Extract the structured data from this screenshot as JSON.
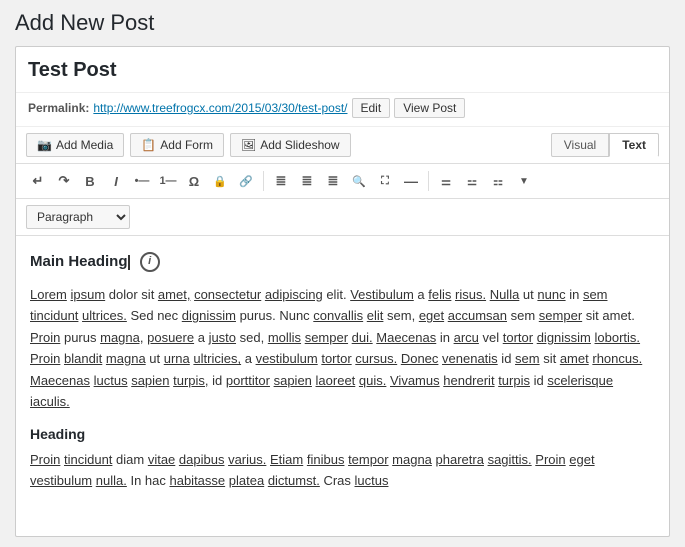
{
  "page": {
    "title": "Add New Post"
  },
  "post": {
    "title": "Test Post",
    "permalink_label": "Permalink:",
    "permalink_url": "http://www.treefrogcx.com/2015/03/30/test-post/",
    "edit_btn": "Edit",
    "view_post_btn": "View Post"
  },
  "toolbar_top": {
    "add_media_label": "Add Media",
    "add_form_label": "Add Form",
    "add_slideshow_label": "Add Slideshow"
  },
  "tabs": {
    "visual_label": "Visual",
    "text_label": "Text"
  },
  "paragraph_select": {
    "value": "Paragraph"
  },
  "toolbar_buttons": [
    {
      "name": "undo",
      "symbol": "↩"
    },
    {
      "name": "redo",
      "symbol": "↪"
    },
    {
      "name": "bold",
      "symbol": "B"
    },
    {
      "name": "italic",
      "symbol": "I"
    },
    {
      "name": "bullet-list",
      "symbol": "≡"
    },
    {
      "name": "numbered-list",
      "symbol": "≣"
    },
    {
      "name": "omega",
      "symbol": "Ω"
    },
    {
      "name": "lock",
      "symbol": "🔒"
    },
    {
      "name": "link",
      "symbol": "🔗"
    },
    {
      "name": "align-left",
      "symbol": "≡"
    },
    {
      "name": "align-center",
      "symbol": "≡"
    },
    {
      "name": "align-right",
      "symbol": "≡"
    },
    {
      "name": "search",
      "symbol": "🔍"
    },
    {
      "name": "image",
      "symbol": "🖼"
    },
    {
      "name": "hr",
      "symbol": "—"
    },
    {
      "name": "table1",
      "symbol": "▦"
    },
    {
      "name": "table2",
      "symbol": "▦"
    },
    {
      "name": "table3",
      "symbol": "▦"
    },
    {
      "name": "more",
      "symbol": "▼"
    }
  ],
  "editor": {
    "main_heading": "Main Heading",
    "paragraph1": "Lorem ipsum dolor sit amet, consectetur adipiscing elit. Vestibulum a felis risus. Nulla ut nunc in sem tincidunt ultrices. Sed nec dignissim purus. Nunc convallis elit sem, eget accumsan sem semper sit amet. Proin purus magna, posuere a justo sed, mollis semper dui. Maecenas in arcu vel tortor dignissim lobortis. Proin blandit magna ut urna ultricies, a vestibulum tortor cursus. Donec venenatis id sem sit amet rhoncus. Maecenas luctus sapien turpis, id porttitor sapien laoreet quis. Vivamus hendrerit turpis id scelerisque iaculis.",
    "subheading": "Heading",
    "paragraph2": "Proin tincidunt diam vitae dapibus varius. Etiam finibus tempor magna pharetra sagittis. Proin eget vestibulum nulla. In hac habitasse platea dictumst. Cras luctus"
  }
}
